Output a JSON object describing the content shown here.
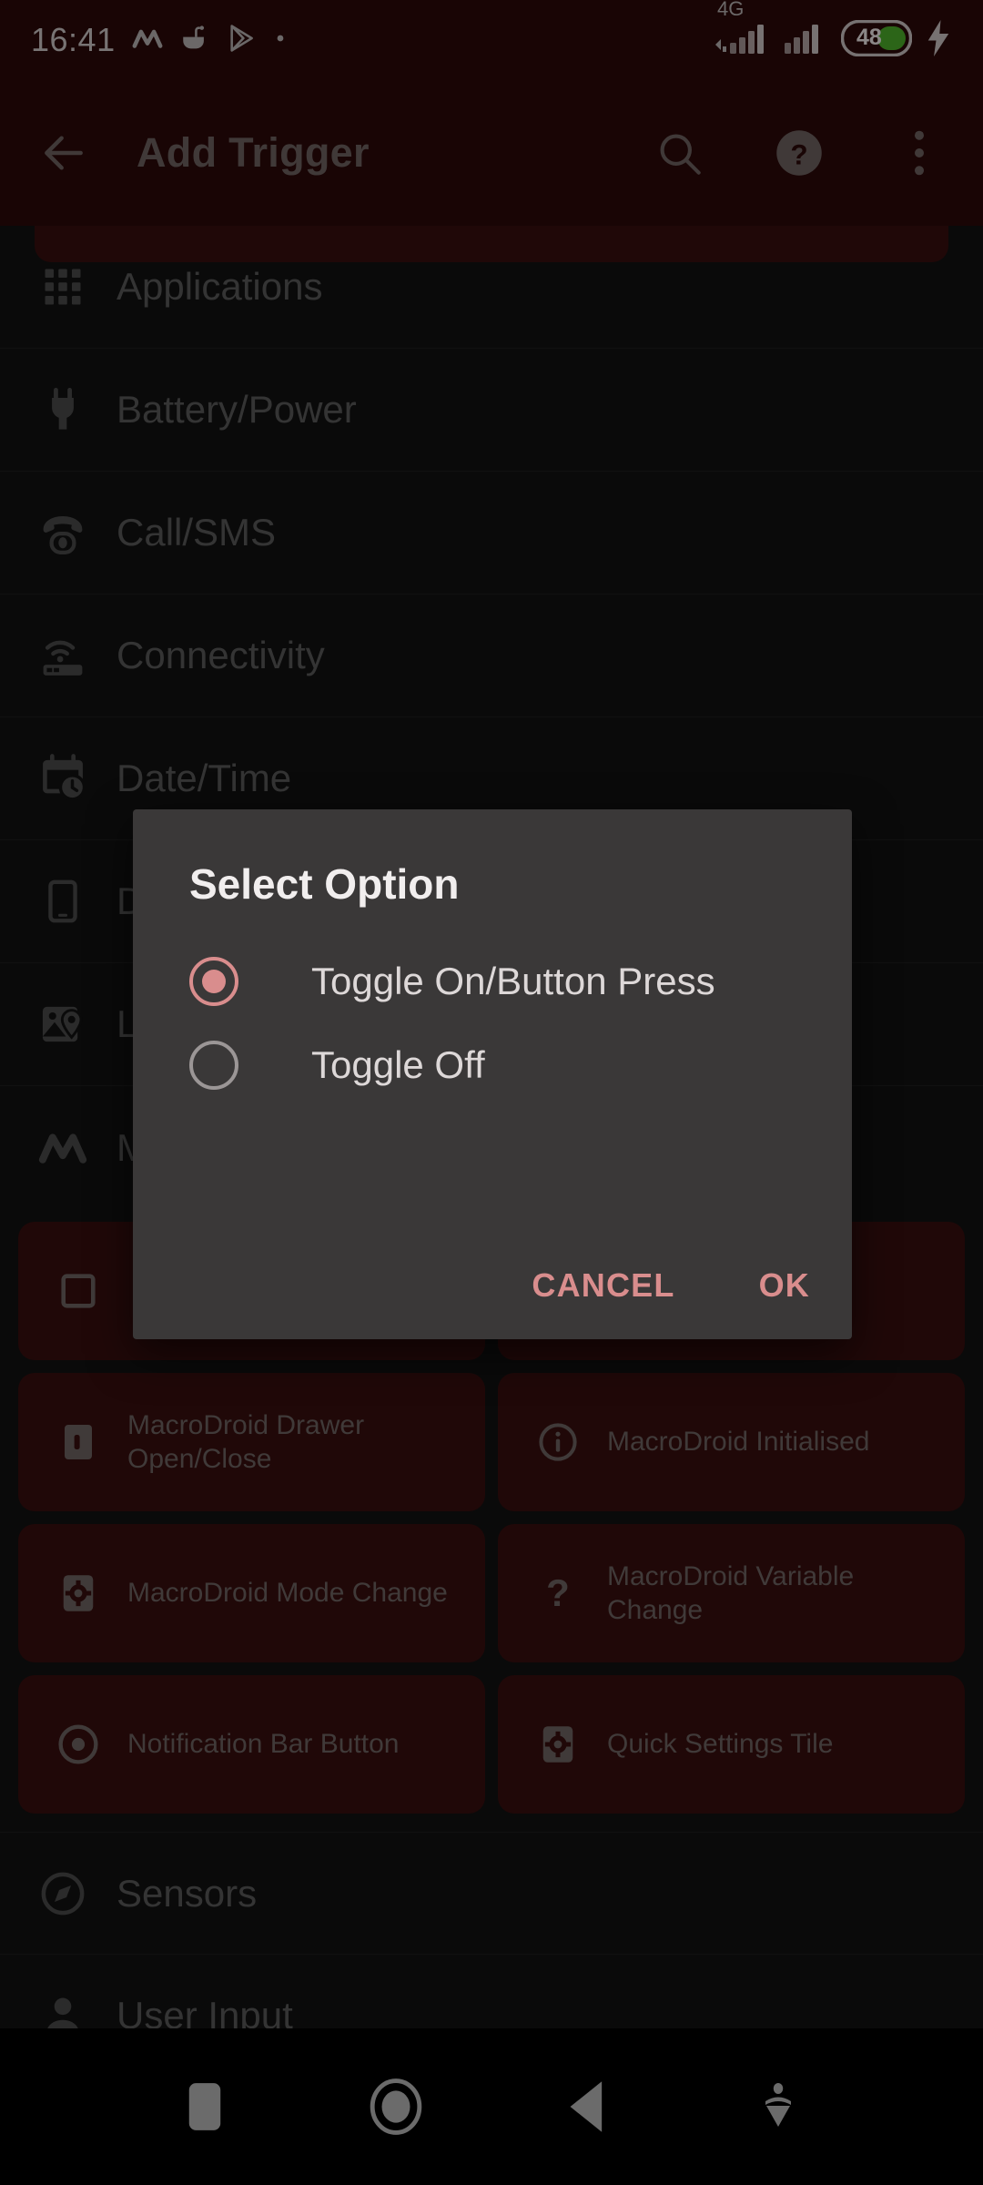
{
  "colors": {
    "app_bar": "#2c0a0a",
    "list_bg": "#121212",
    "card_bg": "#380f0f",
    "dialog_bg": "#3a3838",
    "accent": "#d98d8d",
    "battery_green": "#4caf2a",
    "muted_text": "#5b5b5b"
  },
  "status_bar": {
    "clock": "16:41",
    "left_icons": [
      "macrodroid-icon",
      "coffee-cup-icon",
      "play-store-icon",
      "dot-icon"
    ],
    "network_label": "4G",
    "right_icons": [
      "signal-bars-icon",
      "signal-bars-icon",
      "battery-icon",
      "charging-bolt-icon"
    ],
    "battery_level": "48"
  },
  "app_bar": {
    "back_label": "back-arrow",
    "title": "Add Trigger",
    "actions": [
      {
        "name": "search-icon",
        "label": "Search"
      },
      {
        "name": "help-icon",
        "label": "Help"
      },
      {
        "name": "overflow-menu-icon",
        "label": "More options"
      }
    ]
  },
  "list": {
    "items": [
      {
        "icon": "apps-grid-icon",
        "label": "Applications"
      },
      {
        "icon": "power-plug-icon",
        "label": "Battery/Power"
      },
      {
        "icon": "telephone-icon",
        "label": "Call/SMS"
      },
      {
        "icon": "router-wifi-icon",
        "label": "Connectivity"
      },
      {
        "icon": "calendar-clock-icon",
        "label": "Date/Time"
      },
      {
        "icon": "smartphone-icon",
        "label": "Device Events"
      },
      {
        "icon": "map-pin-icon",
        "label": "Location"
      },
      {
        "icon": "macrodroid-logo-icon",
        "label": "MacroDroid Specific"
      }
    ],
    "tail_items": [
      {
        "icon": "compass-icon",
        "label": "Sensors"
      },
      {
        "icon": "person-icon",
        "label": "User Input"
      }
    ]
  },
  "card_grid": {
    "cards": [
      {
        "icon": "square-outline-icon",
        "label": ""
      },
      {
        "icon": "square-outline-icon",
        "label": ""
      },
      {
        "icon": "drawer-icon",
        "label": "MacroDroid Drawer Open/Close"
      },
      {
        "icon": "info-circle-icon",
        "label": "MacroDroid Initialised"
      },
      {
        "icon": "mode-gear-icon",
        "label": "MacroDroid Mode Change"
      },
      {
        "icon": "question-mark-icon",
        "label": "MacroDroid Variable Change"
      },
      {
        "icon": "target-dot-icon",
        "label": "Notification Bar Button"
      },
      {
        "icon": "quick-settings-gear-icon",
        "label": "Quick Settings Tile"
      }
    ]
  },
  "dialog": {
    "title": "Select Option",
    "options": [
      {
        "label": "Toggle On/Button Press",
        "selected": true
      },
      {
        "label": "Toggle Off",
        "selected": false
      }
    ],
    "cancel_label": "CANCEL",
    "ok_label": "OK"
  },
  "nav_bar": {
    "buttons": [
      {
        "name": "recents-square-icon",
        "label": "Recents"
      },
      {
        "name": "home-circle-icon",
        "label": "Home"
      },
      {
        "name": "back-triangle-icon",
        "label": "Back"
      },
      {
        "name": "hide-keyboard-icon",
        "label": "Hide"
      }
    ]
  }
}
